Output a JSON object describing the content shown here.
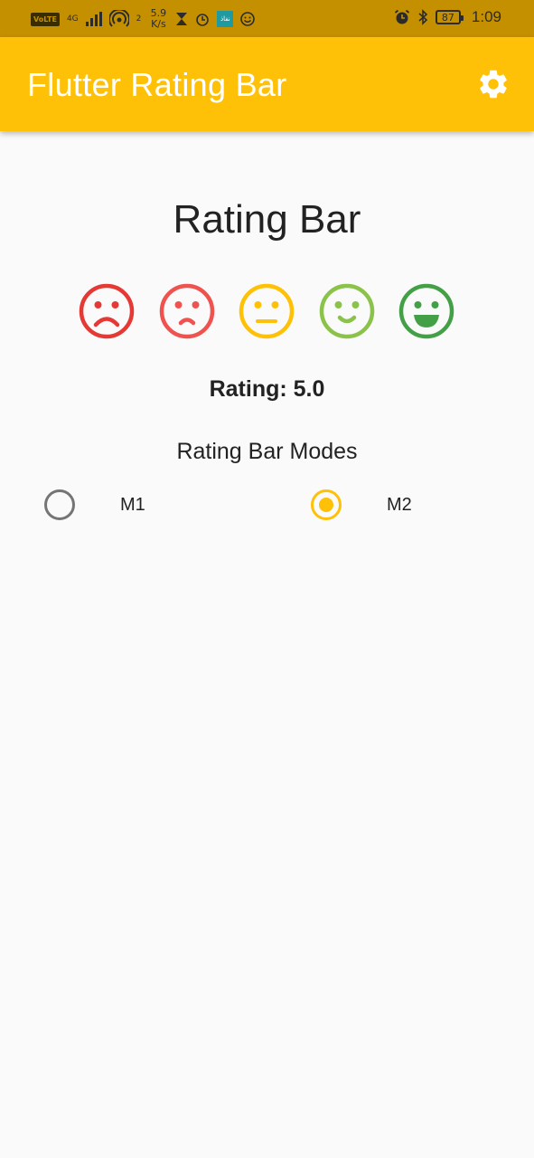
{
  "status_bar": {
    "volte": "VoLTE",
    "network": "4G",
    "hotspot_count": "2",
    "speed_value": "5.9",
    "speed_unit": "K/s",
    "app_badge": "نفاذ",
    "battery": "87",
    "time": "1:09"
  },
  "app_bar": {
    "title": "Flutter Rating Bar",
    "settings_icon": "gear-icon"
  },
  "main": {
    "heading": "Rating Bar",
    "rating_value": 5.0,
    "rating_text": "Rating: 5.0",
    "faces": [
      {
        "icon": "very-dissatisfied-icon",
        "color": "#e53935"
      },
      {
        "icon": "dissatisfied-icon",
        "color": "#ef5350"
      },
      {
        "icon": "neutral-icon",
        "color": "#ffc107"
      },
      {
        "icon": "satisfied-icon",
        "color": "#8bc34a"
      },
      {
        "icon": "very-satisfied-icon",
        "color": "#43a047"
      }
    ],
    "modes_title": "Rating Bar Modes",
    "modes": [
      {
        "label": "M1",
        "selected": false
      },
      {
        "label": "M2",
        "selected": true
      }
    ]
  },
  "colors": {
    "accent": "#ffc107",
    "status_bar": "#c49000",
    "background": "#fafafa"
  }
}
